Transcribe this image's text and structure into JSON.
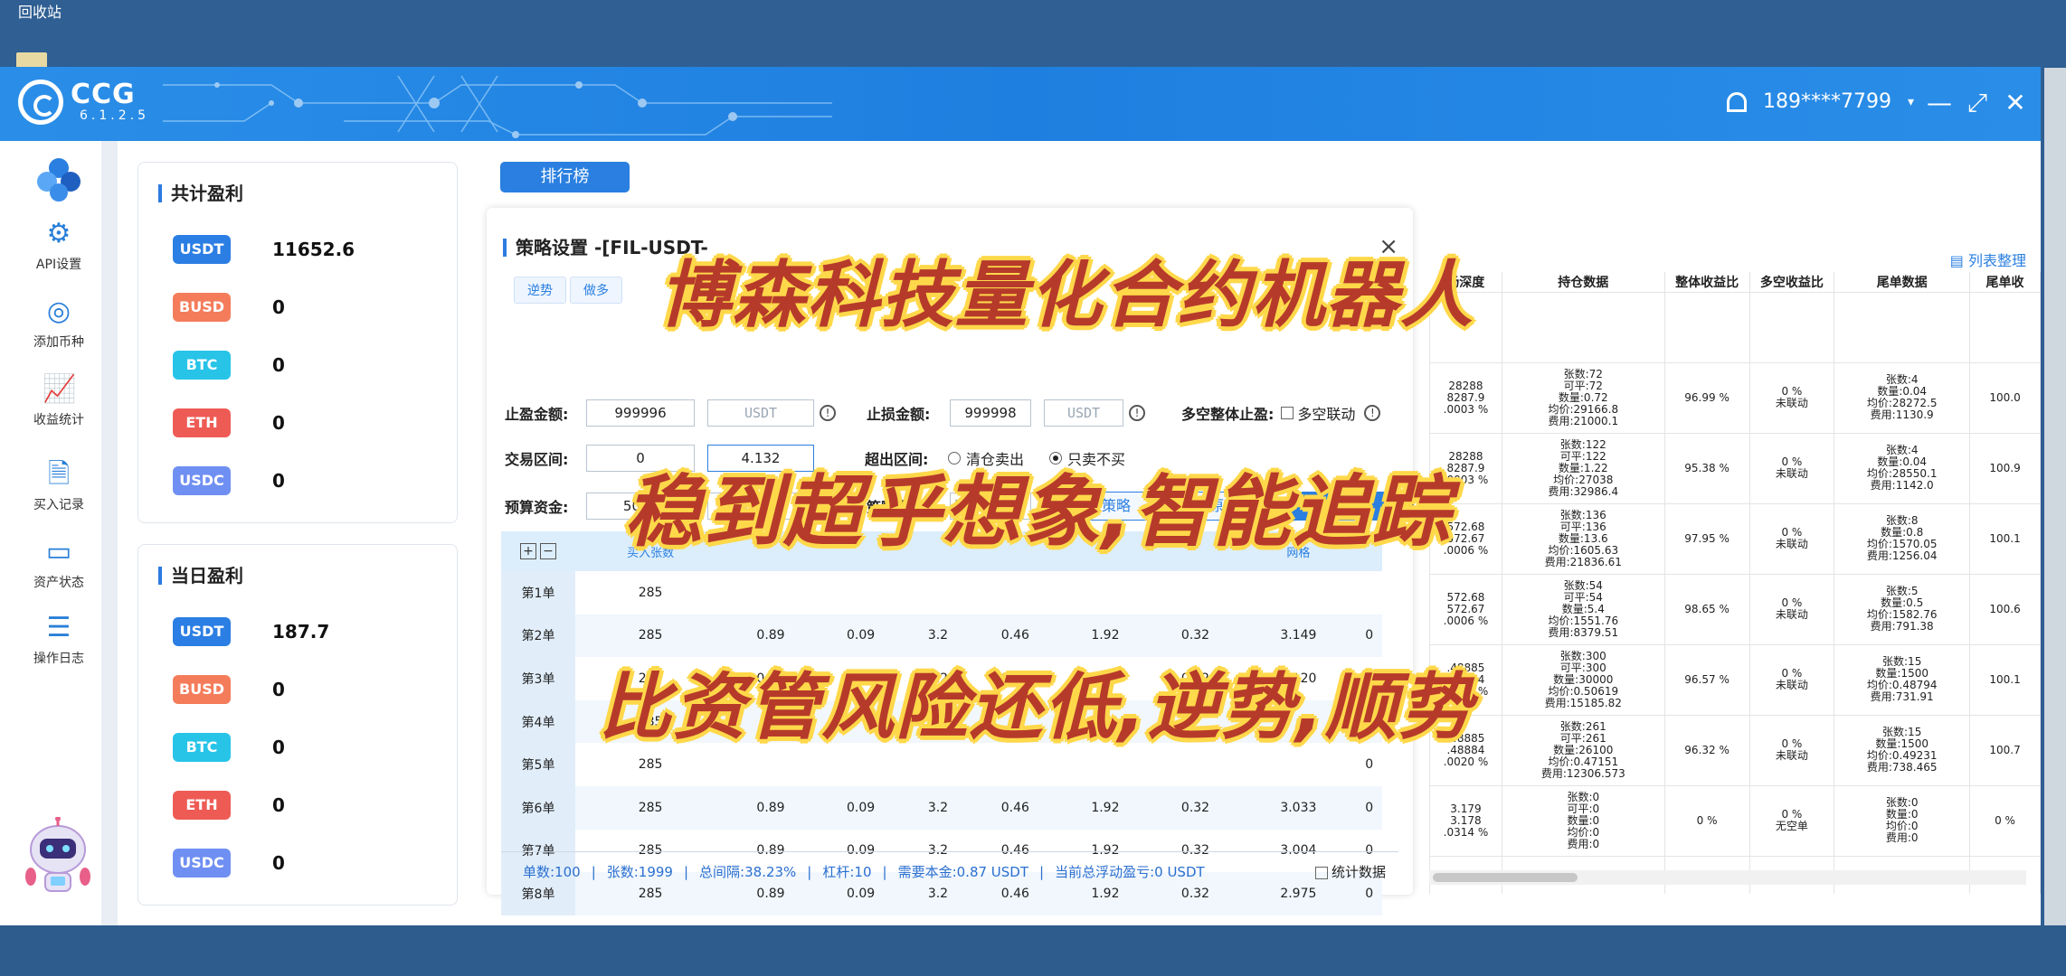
{
  "desktop": {
    "recycle_bin_label": "回收站"
  },
  "header": {
    "logo_name": "CCG",
    "version": "6.1.2.5",
    "user_phone": "189****7799",
    "user_caret": "▾",
    "minimize_glyph": "—",
    "maximize_glyph": "⤢",
    "close_glyph": "✕"
  },
  "sidebar": {
    "items": [
      {
        "label": "API设置",
        "icon": "gear-icon"
      },
      {
        "label": "添加币种",
        "icon": "coin-icon"
      },
      {
        "label": "收益统计",
        "icon": "chart-icon"
      },
      {
        "label": "买入记录",
        "icon": "record-icon"
      },
      {
        "label": "资产状态",
        "icon": "wallet-icon"
      },
      {
        "label": "操作日志",
        "icon": "log-icon"
      }
    ]
  },
  "total_profit": {
    "title": "共计盈利",
    "rows": [
      {
        "coin": "USDT",
        "value": "11652.6",
        "color": "#2b7ee3"
      },
      {
        "coin": "BUSD",
        "value": "0",
        "color": "#f47c5a"
      },
      {
        "coin": "BTC",
        "value": "0",
        "color": "#27c4e8"
      },
      {
        "coin": "ETH",
        "value": "0",
        "color": "#ee5b55"
      },
      {
        "coin": "USDC",
        "value": "0",
        "color": "#6f8ff2"
      }
    ]
  },
  "daily_profit": {
    "title": "当日盈利",
    "rows": [
      {
        "coin": "USDT",
        "value": "187.7",
        "color": "#2b7ee3"
      },
      {
        "coin": "BUSD",
        "value": "0",
        "color": "#f47c5a"
      },
      {
        "coin": "BTC",
        "value": "0",
        "color": "#27c4e8"
      },
      {
        "coin": "ETH",
        "value": "0",
        "color": "#ee5b55"
      },
      {
        "coin": "USDC",
        "value": "0",
        "color": "#6f8ff2"
      }
    ]
  },
  "ranking_button": "排行榜",
  "modal": {
    "title": "策略设置 -[FIL-USDT-",
    "close": "×",
    "tabs": [
      "逆势",
      "做多"
    ],
    "take_profit_label": "止盈金额:",
    "take_profit_value": "999996",
    "take_profit_unit": "USDT",
    "stop_loss_label": "止损金额:",
    "stop_loss_value": "999998",
    "stop_loss_unit": "USDT",
    "long_short_label": "多空整体止盈:",
    "long_short_link_label": "多空联动",
    "range_label": "交易区间:",
    "range_low": "0",
    "range_high": "4.132",
    "exceed_label": "超出区间:",
    "exceed_opt1": "清仓卖出",
    "exceed_opt2": "只卖不买",
    "budget_label": "预算资金:",
    "budget_value": "5000",
    "budget_unit": "USDT",
    "strategy_type_label": "策略类型:",
    "strategy_type_value": "平推",
    "preview_btn": "预览策略",
    "restore_btn": "还原策略",
    "save_btn": "保存策略",
    "help": "?",
    "table_headers": [
      "买入张数",
      "",
      "",
      "",
      "",
      "",
      "",
      "网格",
      ""
    ],
    "rows": [
      [
        "第1单",
        "285",
        "",
        "",
        "",
        "",
        "",
        "",
        "",
        ""
      ],
      [
        "第2单",
        "285",
        "0.89",
        "0.09",
        "3.2",
        "0.46",
        "1.92",
        "0.32",
        "3.149",
        "0"
      ],
      [
        "第3单",
        "285",
        "0.89",
        "0.09",
        "3.2",
        "0.46",
        "1.92",
        "0.32",
        "3.120",
        "0"
      ],
      [
        "第4单",
        "285",
        "",
        "",
        "",
        "",
        "",
        "",
        "",
        "0"
      ],
      [
        "第5单",
        "285",
        "",
        "",
        "",
        "",
        "",
        "",
        "",
        "0"
      ],
      [
        "第6单",
        "285",
        "0.89",
        "0.09",
        "3.2",
        "0.46",
        "1.92",
        "0.32",
        "3.033",
        "0"
      ],
      [
        "第7单",
        "285",
        "0.89",
        "0.09",
        "3.2",
        "0.46",
        "1.92",
        "0.32",
        "3.004",
        "0"
      ],
      [
        "第8单",
        "285",
        "0.89",
        "0.09",
        "3.2",
        "0.46",
        "1.92",
        "0.32",
        "2.975",
        "0"
      ]
    ],
    "footer": {
      "orders": "单数:100",
      "contracts": "张数:1999",
      "total_range": "总间隔:38.23%",
      "leverage": "杠杆:10",
      "required_capital": "需要本金:0.87 USDT",
      "floating_pnl": "当前总浮动盈亏:0 USDT",
      "stats_label": "统计数据"
    }
  },
  "right_grid": {
    "list_sort": "列表整理",
    "headers": [
      "场深度",
      "持仓数据",
      "整体收益比",
      "多空收益比",
      "尾单数据",
      "尾单收"
    ],
    "rows": [
      [
        "",
        "",
        "",
        "",
        "",
        ""
      ],
      [
        "28288\n8287.9\n.0003 %",
        "张数:72\n可平:72\n数量:0.72\n均价:29166.8\n费用:21000.1",
        "96.99 %",
        "0 %\n未联动",
        "张数:4\n数量:0.04\n均价:28272.5\n费用:1130.9",
        "100.0"
      ],
      [
        "28288\n8287.9\n.0003 %",
        "张数:122\n可平:122\n数量:1.22\n均价:27038\n费用:32986.4",
        "95.38 %",
        "0 %\n未联动",
        "张数:4\n数量:0.04\n均价:28550.1\n费用:1142.0",
        "100.9"
      ],
      [
        "572.68\n572.67\n.0006 %",
        "张数:136\n可平:136\n数量:13.6\n均价:1605.63\n费用:21836.61",
        "97.95 %",
        "0 %\n未联动",
        "张数:8\n数量:0.8\n均价:1570.05\n费用:1256.04",
        "100.1"
      ],
      [
        "572.68\n572.67\n.0006 %",
        "张数:54\n可平:54\n数量:5.4\n均价:1551.76\n费用:8379.51",
        "98.65 %",
        "0 %\n未联动",
        "张数:5\n数量:0.5\n均价:1582.76\n费用:791.38",
        "100.6"
      ],
      [
        ".48885\n.48884\n.0020 %",
        "张数:300\n可平:300\n数量:30000\n均价:0.50619\n费用:15185.82",
        "96.57 %",
        "0 %\n未联动",
        "张数:15\n数量:1500\n均价:0.48794\n费用:731.91",
        "100.1"
      ],
      [
        ".48885\n.48884\n.0020 %",
        "张数:261\n可平:261\n数量:26100\n均价:0.47151\n费用:12306.573",
        "96.32 %",
        "0 %\n未联动",
        "张数:15\n数量:1500\n均价:0.49231\n费用:738.465",
        "100.7"
      ],
      [
        "3.179\n3.178\n.0314 %",
        "张数:0\n可平:0\n数量:0\n均价:0\n费用:0",
        "0 %",
        "0 %\n无空单",
        "张数:0\n数量:0\n均价:0\n费用:0",
        "0 %"
      ],
      [
        "",
        "",
        "",
        "",
        "",
        ""
      ]
    ]
  },
  "overlay": {
    "line1": "博森科技量化合约机器人",
    "line2": "稳到超乎想象,智能追踪",
    "line3": "比资管风险还低,逆势,顺势"
  }
}
